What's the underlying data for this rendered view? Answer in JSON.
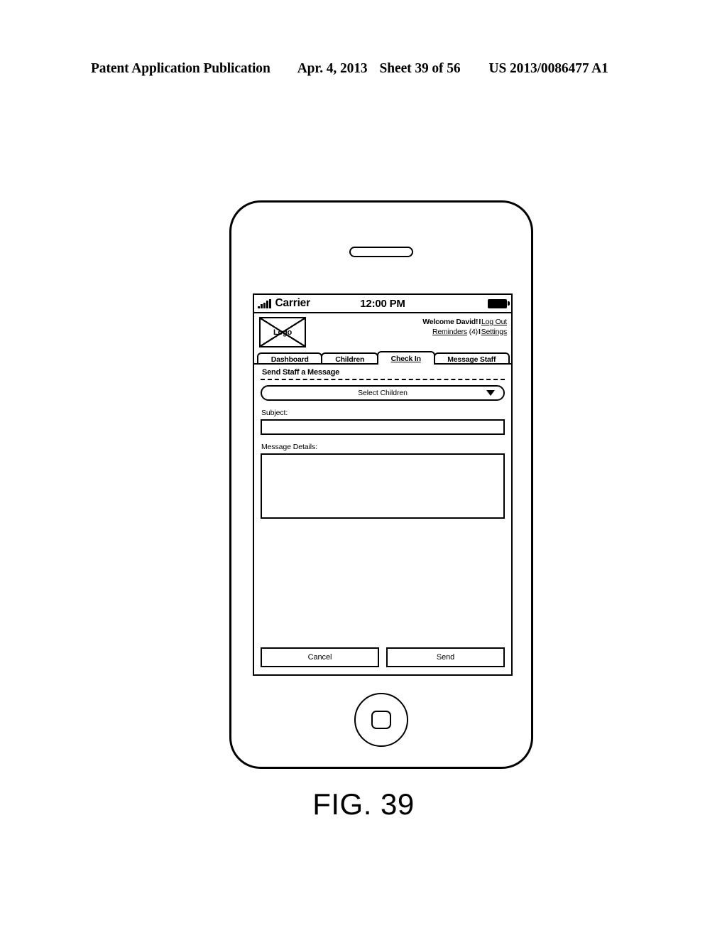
{
  "patent_header": {
    "publication": "Patent Application Publication",
    "date": "Apr. 4, 2013",
    "sheet": "Sheet 39 of 56",
    "number": "US 2013/0086477 A1"
  },
  "figure": {
    "caption": "FIG. 39"
  },
  "device": {
    "speaker_icon": "speaker-slot-icon",
    "home_button_icon": "home-button-icon"
  },
  "status_bar": {
    "signal_icon": "signal-bars-icon",
    "carrier": "Carrier",
    "time": "12:00 PM",
    "battery_icon": "battery-full-icon"
  },
  "app_header": {
    "logo_placeholder": "Logo",
    "welcome_text": "Welcome David!",
    "separator": "I",
    "log_out": "Log Out",
    "reminders_label": "Reminders",
    "reminders_count": "(4)",
    "settings": "Settings"
  },
  "tabs": [
    {
      "label": "Dashboard",
      "active": false
    },
    {
      "label": "Children",
      "active": false
    },
    {
      "label": "Check In",
      "active": true
    },
    {
      "label": "Message Staff",
      "active": false
    }
  ],
  "main": {
    "section_title": "Send Staff a Message",
    "select_children": {
      "value": "Select Children",
      "caret_icon": "chevron-down-icon"
    },
    "subject": {
      "label": "Subject:",
      "value": ""
    },
    "message_details": {
      "label": "Message Details:",
      "value": ""
    }
  },
  "actions": {
    "cancel_label": "Cancel",
    "send_label": "Send"
  }
}
